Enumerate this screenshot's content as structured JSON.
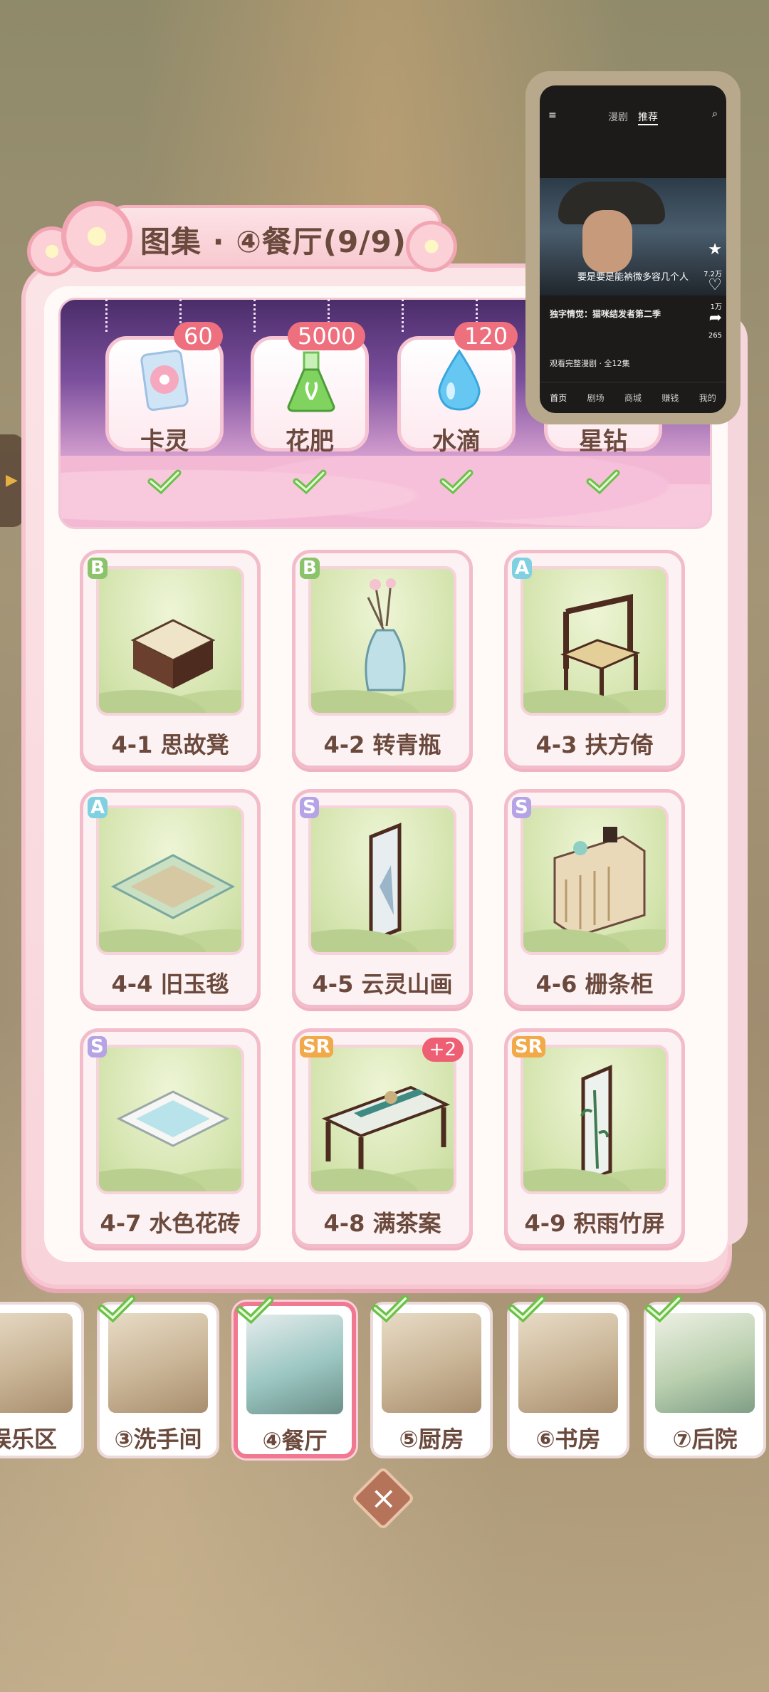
{
  "album": {
    "title": "图集 · ④餐厅(9/9)"
  },
  "rewards": [
    {
      "name": "卡灵",
      "count": "60",
      "icon": "card-spirit-icon",
      "claimed": true
    },
    {
      "name": "花肥",
      "count": "5000",
      "icon": "fertilizer-flask-icon",
      "claimed": true
    },
    {
      "name": "水滴",
      "count": "120",
      "icon": "water-drop-icon",
      "claimed": true
    },
    {
      "name": "星钻",
      "count": "",
      "icon": "star-diamond-icon",
      "claimed": true
    }
  ],
  "items": [
    {
      "grade": "B",
      "label": "4-1 思故凳"
    },
    {
      "grade": "B",
      "label": "4-2 转青瓶"
    },
    {
      "grade": "A",
      "label": "4-3 扶方倚"
    },
    {
      "grade": "A",
      "label": "4-4 旧玉毯"
    },
    {
      "grade": "S",
      "label": "4-5 云灵山画"
    },
    {
      "grade": "S",
      "label": "4-6 栅条柜"
    },
    {
      "grade": "S",
      "label": "4-7 水色花砖"
    },
    {
      "grade": "SR",
      "label": "4-8 满茶案",
      "badge": "+2"
    },
    {
      "grade": "SR",
      "label": "4-9 积雨竹屏"
    }
  ],
  "rooms": [
    {
      "label": "娱乐区",
      "checked": false
    },
    {
      "label": "③洗手间",
      "checked": true
    },
    {
      "label": "④餐厅",
      "checked": true,
      "active": true
    },
    {
      "label": "⑤厨房",
      "checked": true
    },
    {
      "label": "⑥书房",
      "checked": true
    },
    {
      "label": "⑦后院",
      "checked": true
    }
  ],
  "phone_overlay": {
    "tabs": [
      "漫剧",
      "推荐"
    ],
    "caption": "要是要是能衲微多容几个人",
    "likes": "7.2万",
    "favs": "1万",
    "shares": "265",
    "title": "独字情觉：猫咪结发者第二季",
    "nav": [
      "首页",
      "剧场",
      "商城",
      "赚钱",
      "我的"
    ],
    "footer": "观看完整漫剧 · 全12集"
  },
  "colors": {
    "accent": "#ee6f7e",
    "panel": "#f6c5cf",
    "text": "#6b4a3d"
  }
}
